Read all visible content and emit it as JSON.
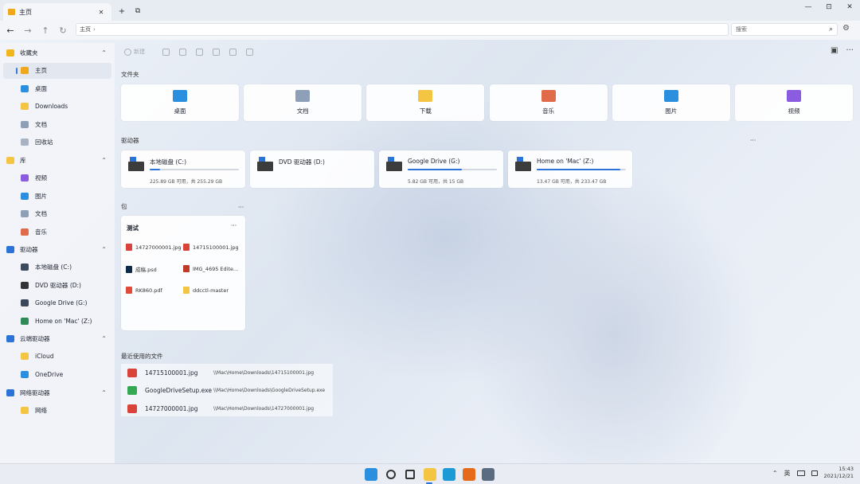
{
  "tab": {
    "title": "主页",
    "close": "✕",
    "new_tab": "+",
    "tab_actions": "⧉"
  },
  "window_controls": {
    "minimize": "—",
    "maximize": "⊡",
    "close": "✕"
  },
  "nav": {
    "back": "←",
    "forward": "→",
    "up": "↑",
    "refresh": "↻",
    "address": "主页",
    "address_chevron": "›"
  },
  "search": {
    "placeholder": "搜索",
    "icon": "⌕"
  },
  "settings_icon": "⚙",
  "toolbar": {
    "new_label": "新建",
    "more": "···",
    "view_icon": "▣"
  },
  "sidebar": {
    "sections": [
      {
        "label": "收藏夹",
        "icon_color": "#f2b61b",
        "items": [
          {
            "label": "主页",
            "icon_color": "#f0a81a",
            "selected": true
          },
          {
            "label": "桌面",
            "icon_color": "#2b8fe0"
          },
          {
            "label": "Downloads",
            "icon_color": "#f4c542"
          },
          {
            "label": "文档",
            "icon_color": "#8da0b8"
          },
          {
            "label": "回收站",
            "icon_color": "#a7b2c2"
          }
        ]
      },
      {
        "label": "库",
        "icon_color": "#f4c542",
        "items": [
          {
            "label": "视频",
            "icon_color": "#8b5be0"
          },
          {
            "label": "图片",
            "icon_color": "#2b8fe0"
          },
          {
            "label": "文档",
            "icon_color": "#8da0b8"
          },
          {
            "label": "音乐",
            "icon_color": "#e06a4a"
          }
        ]
      },
      {
        "label": "驱动器",
        "icon_color": "#2b73d6",
        "items": [
          {
            "label": "本地磁盘 (C:)",
            "icon_color": "#3a4a5c"
          },
          {
            "label": "DVD 驱动器 (D:)",
            "icon_color": "#333333"
          },
          {
            "label": "Google Drive (G:)",
            "icon_color": "#3a4a5c"
          },
          {
            "label": "Home on 'Mac' (Z:)",
            "icon_color": "#2e8b57"
          }
        ]
      },
      {
        "label": "云端驱动器",
        "icon_color": "#2b73d6",
        "items": [
          {
            "label": "iCloud",
            "icon_color": "#f4c542"
          },
          {
            "label": "OneDrive",
            "icon_color": "#2b8fe0"
          }
        ]
      },
      {
        "label": "网络驱动器",
        "icon_color": "#2b73d6",
        "items": [
          {
            "label": "网络",
            "icon_color": "#f4c542"
          }
        ]
      }
    ],
    "chevron": "⌃"
  },
  "folders_title": "文件夹",
  "folders": [
    {
      "label": "桌面",
      "icon_color": "#2b8fe0"
    },
    {
      "label": "文档",
      "icon_color": "#8da0b8"
    },
    {
      "label": "下载",
      "icon_color": "#f4c542"
    },
    {
      "label": "音乐",
      "icon_color": "#e06a4a"
    },
    {
      "label": "图片",
      "icon_color": "#2b8fe0"
    },
    {
      "label": "视频",
      "icon_color": "#8b5be0"
    }
  ],
  "drives_title": "驱动器",
  "drives_more": "···",
  "drives": [
    {
      "name": "本地磁盘 (C:)",
      "status": "225.89 GB 可用，共 255.29 GB",
      "used_fraction": 0.12,
      "show_bar": true
    },
    {
      "name": "DVD 驱动器 (D:)",
      "status": "",
      "used_fraction": 0,
      "show_bar": false
    },
    {
      "name": "Google Drive (G:)",
      "status": "5.82 GB 可用，共 15 GB",
      "used_fraction": 0.61,
      "show_bar": true
    },
    {
      "name": "Home on 'Mac' (Z:)",
      "status": "13.47 GB 可用，共 233.47 GB",
      "used_fraction": 0.94,
      "show_bar": true
    }
  ],
  "pinned_title": "包",
  "pinned_more": "···",
  "pinned_card": {
    "title": "测试",
    "more": "···",
    "items": [
      {
        "label": "14727000001.jpg",
        "icon_color": "#d9433a"
      },
      {
        "label": "14715100001.jpg",
        "icon_color": "#d9433a"
      },
      {
        "label": "成稿.psd",
        "icon_color": "#0d2a4a"
      },
      {
        "label": "IMG_4695 Edite...",
        "icon_color": "#c0392b"
      },
      {
        "label": "RK860.pdf",
        "icon_color": "#e04a3a"
      },
      {
        "label": "ddcctl-master",
        "icon_color": "#f4c542"
      }
    ]
  },
  "recent_title": "最近使用的文件",
  "recent": [
    {
      "name": "14715100001.jpg",
      "path": "\\\\Mac\\Home\\Downloads\\14715100001.jpg",
      "icon_color": "#d9433a"
    },
    {
      "name": "GoogleDriveSetup.exe",
      "path": "\\\\Mac\\Home\\Downloads\\GoogleDriveSetup.exe",
      "icon_color": "#34a853"
    },
    {
      "name": "14727000001.jpg",
      "path": "\\\\Mac\\Home\\Downloads\\14727000001.jpg",
      "icon_color": "#d9433a"
    }
  ],
  "taskbar": {
    "apps": [
      {
        "name": "start",
        "color": "#2b8fe0"
      },
      {
        "name": "search",
        "color": "#333333"
      },
      {
        "name": "task-view",
        "color": "#333333"
      },
      {
        "name": "file-explorer",
        "color": "#f4c542"
      },
      {
        "name": "edge",
        "color": "#1c9ad6"
      },
      {
        "name": "firefox",
        "color": "#e66a1c"
      },
      {
        "name": "settings",
        "color": "#5b6b80"
      }
    ]
  },
  "tray": {
    "chevron": "⌃",
    "ime": "英",
    "time": "15:43",
    "date": "2021/12/21"
  }
}
